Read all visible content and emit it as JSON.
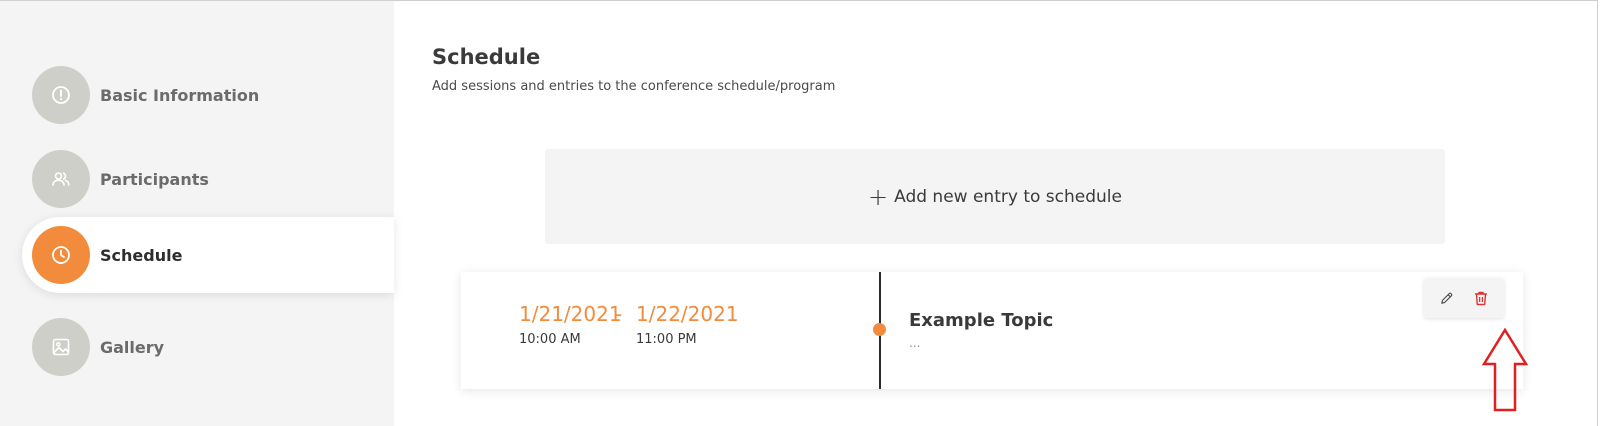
{
  "sidebar": {
    "items": [
      {
        "label": "Basic Information",
        "icon": "info-circle-icon",
        "active": false
      },
      {
        "label": "Participants",
        "icon": "users-icon",
        "active": false
      },
      {
        "label": "Schedule",
        "icon": "clock-icon",
        "active": true
      },
      {
        "label": "Gallery",
        "icon": "image-icon",
        "active": false
      }
    ]
  },
  "main": {
    "title": "Schedule",
    "subtitle": "Add sessions and entries to the conference schedule/program",
    "add_entry": {
      "plus": "+",
      "label": "Add new entry to schedule"
    },
    "entry": {
      "start_date": "1/21/2021",
      "start_time": "10:00 AM",
      "separator": "-",
      "end_date": "1/22/2021",
      "end_time": "11:00 PM",
      "topic": "Example Topic",
      "description": "..."
    },
    "actions": {
      "edit_icon": "pencil-icon",
      "delete_icon": "trash-icon"
    }
  },
  "colors": {
    "accent": "#f28c3c",
    "sidebar_bg": "#f4f4f4",
    "inactive_circle": "#cfcfca",
    "delete": "#e03232",
    "annotation": "#e02020"
  }
}
